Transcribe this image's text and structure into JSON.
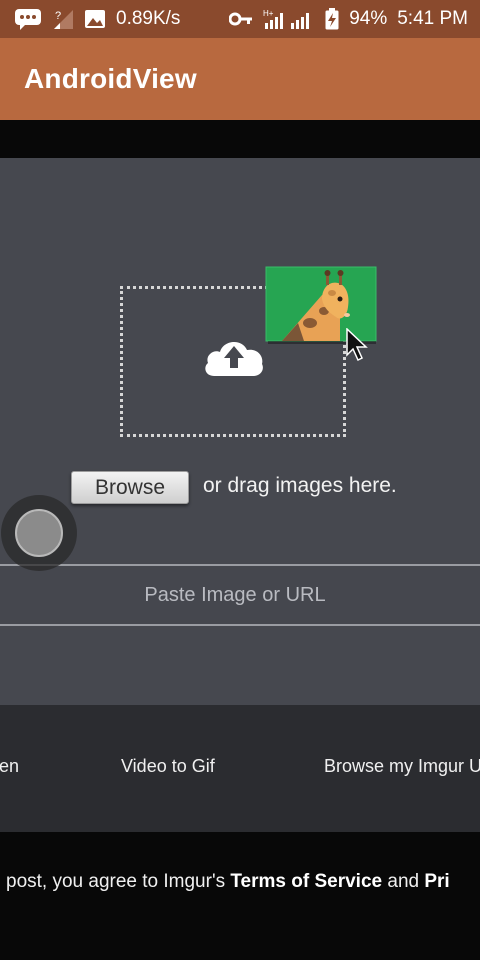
{
  "status_bar": {
    "speed": "0.89K/s",
    "battery": "94%",
    "time": "5:41 PM",
    "network": "H+",
    "icons": [
      "chat-icon",
      "signal-weak-icon",
      "image-icon",
      "key-icon",
      "signal-icon",
      "battery-charging-icon"
    ]
  },
  "app_bar": {
    "title": "AndroidView"
  },
  "upload": {
    "browse_label": "Browse",
    "drag_text": "or drag images here.",
    "url_placeholder": "Paste Image or URL"
  },
  "options": {
    "item1": "en",
    "item2": "Video to Gif",
    "item3": "Browse my Imgur U"
  },
  "footer": {
    "prefix": "post, you agree to Imgur's ",
    "terms": "Terms of Service",
    "and": " and ",
    "privacy": "Pri"
  },
  "colors": {
    "status_bar": "#8a4a2d",
    "app_bar": "#b8693f",
    "panel": "#46484f",
    "options_bar": "#2b2c30",
    "page": "#080808"
  }
}
